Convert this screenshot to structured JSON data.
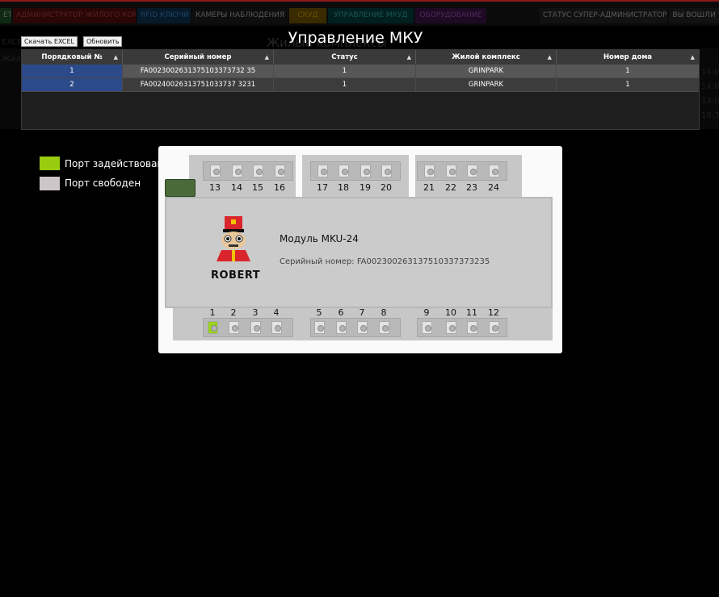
{
  "nav": {
    "items": [
      {
        "label": "ЕТ"
      },
      {
        "label": "АДМИНИСТРАТОР ЖИЛОГО КОМПЛЕКСА"
      },
      {
        "label": "RFID КЛЮЧИ"
      },
      {
        "label": "КАМЕРЫ НАБЛЮДЕНИЯ"
      },
      {
        "label": "СКУД"
      },
      {
        "label": "УПРАВЛЕНИЕ МКУД"
      },
      {
        "label": "ОБОРУДОВАНИЕ"
      },
      {
        "label": "СТАТУС СУПЕР-АДМИНИСТРАТОР"
      },
      {
        "label": "ВЫ ВОШЛИ"
      }
    ]
  },
  "page": {
    "title": "Управление МКУ",
    "ghost_title": "Жилые комплексы",
    "ghost_left": "EXCEL",
    "ghost_left2": "Жил",
    "ghost_times": [
      "14:03",
      "14:05",
      "13:00",
      "19:38"
    ]
  },
  "toolbar": {
    "excel_label": "Скачать EXCEL",
    "refresh_label": "Обновить"
  },
  "table": {
    "columns": [
      "Порядковый №",
      "Серийный номер",
      "Статус",
      "Жилой комплекс",
      "Номер дома"
    ],
    "sort_glyph": "▲",
    "rows": [
      [
        "1",
        "FA0023002631375103373732 35",
        "1",
        "GRINPARK",
        "1"
      ],
      [
        "2",
        "FA00240026313751033737 3231",
        "1",
        "GRINPARK",
        "1"
      ]
    ]
  },
  "legend": {
    "used_label": "Порт задействован",
    "free_label": "Порт свободен",
    "used_color": "#97cc0f",
    "free_color": "#cdc6c8"
  },
  "module": {
    "name": "Модуль MKU-24",
    "serial": "Серийный номер: FA002300263137510337373235",
    "brand": "ROBERT",
    "top_ports": [
      "13",
      "14",
      "15",
      "16",
      "17",
      "18",
      "19",
      "20",
      "21",
      "22",
      "23",
      "24"
    ],
    "bottom_ports": [
      "1",
      "2",
      "3",
      "4",
      "5",
      "6",
      "7",
      "8",
      "9",
      "10",
      "11",
      "12"
    ],
    "active_ports": [
      "1"
    ]
  }
}
